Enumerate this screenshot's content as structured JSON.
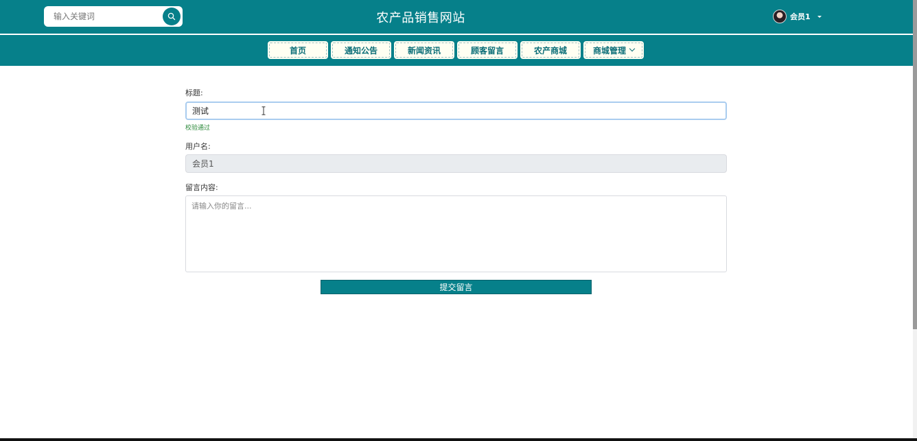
{
  "header": {
    "site_title": "农产品销售网站",
    "search_placeholder": "输入关键词",
    "username": "会员1"
  },
  "nav": {
    "items": [
      {
        "label": "首页"
      },
      {
        "label": "通知公告"
      },
      {
        "label": "新闻资讯"
      },
      {
        "label": "顾客留言"
      },
      {
        "label": "农产商城"
      },
      {
        "label": "商城管理"
      }
    ]
  },
  "form": {
    "title_label": "标题:",
    "title_value": "测试",
    "validation_message": "校验通过",
    "username_label": "用户名:",
    "username_value": "会员1",
    "content_label": "留言内容:",
    "content_placeholder": "请输入你的留言...",
    "submit_label": "提交留言"
  },
  "colors": {
    "primary": "#06808a",
    "success": "#2d8a3c",
    "input_focus_border": "#a9ccef"
  }
}
